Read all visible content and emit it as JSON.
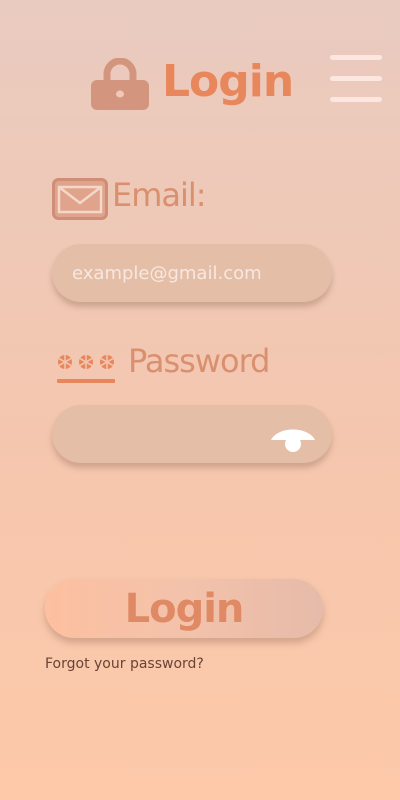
{
  "header": {
    "title": "Login",
    "lock_icon": "lock-icon",
    "menu_icon": "hamburger-menu-icon"
  },
  "form": {
    "email": {
      "label": "Email:",
      "icon": "envelope-icon",
      "placeholder": "example@gmail.com",
      "value": ""
    },
    "password": {
      "label": "Password",
      "icon": "password-asterisks-icon",
      "value": "",
      "toggle_icon": "eye-icon"
    },
    "submit_label": "Login",
    "forgot_label": "Forgot your password?"
  },
  "colors": {
    "accent": "#e9875c",
    "label": "#d9906f",
    "field_bg": "#e5bea7",
    "icon": "#d4957e",
    "link": "#6a4434"
  }
}
